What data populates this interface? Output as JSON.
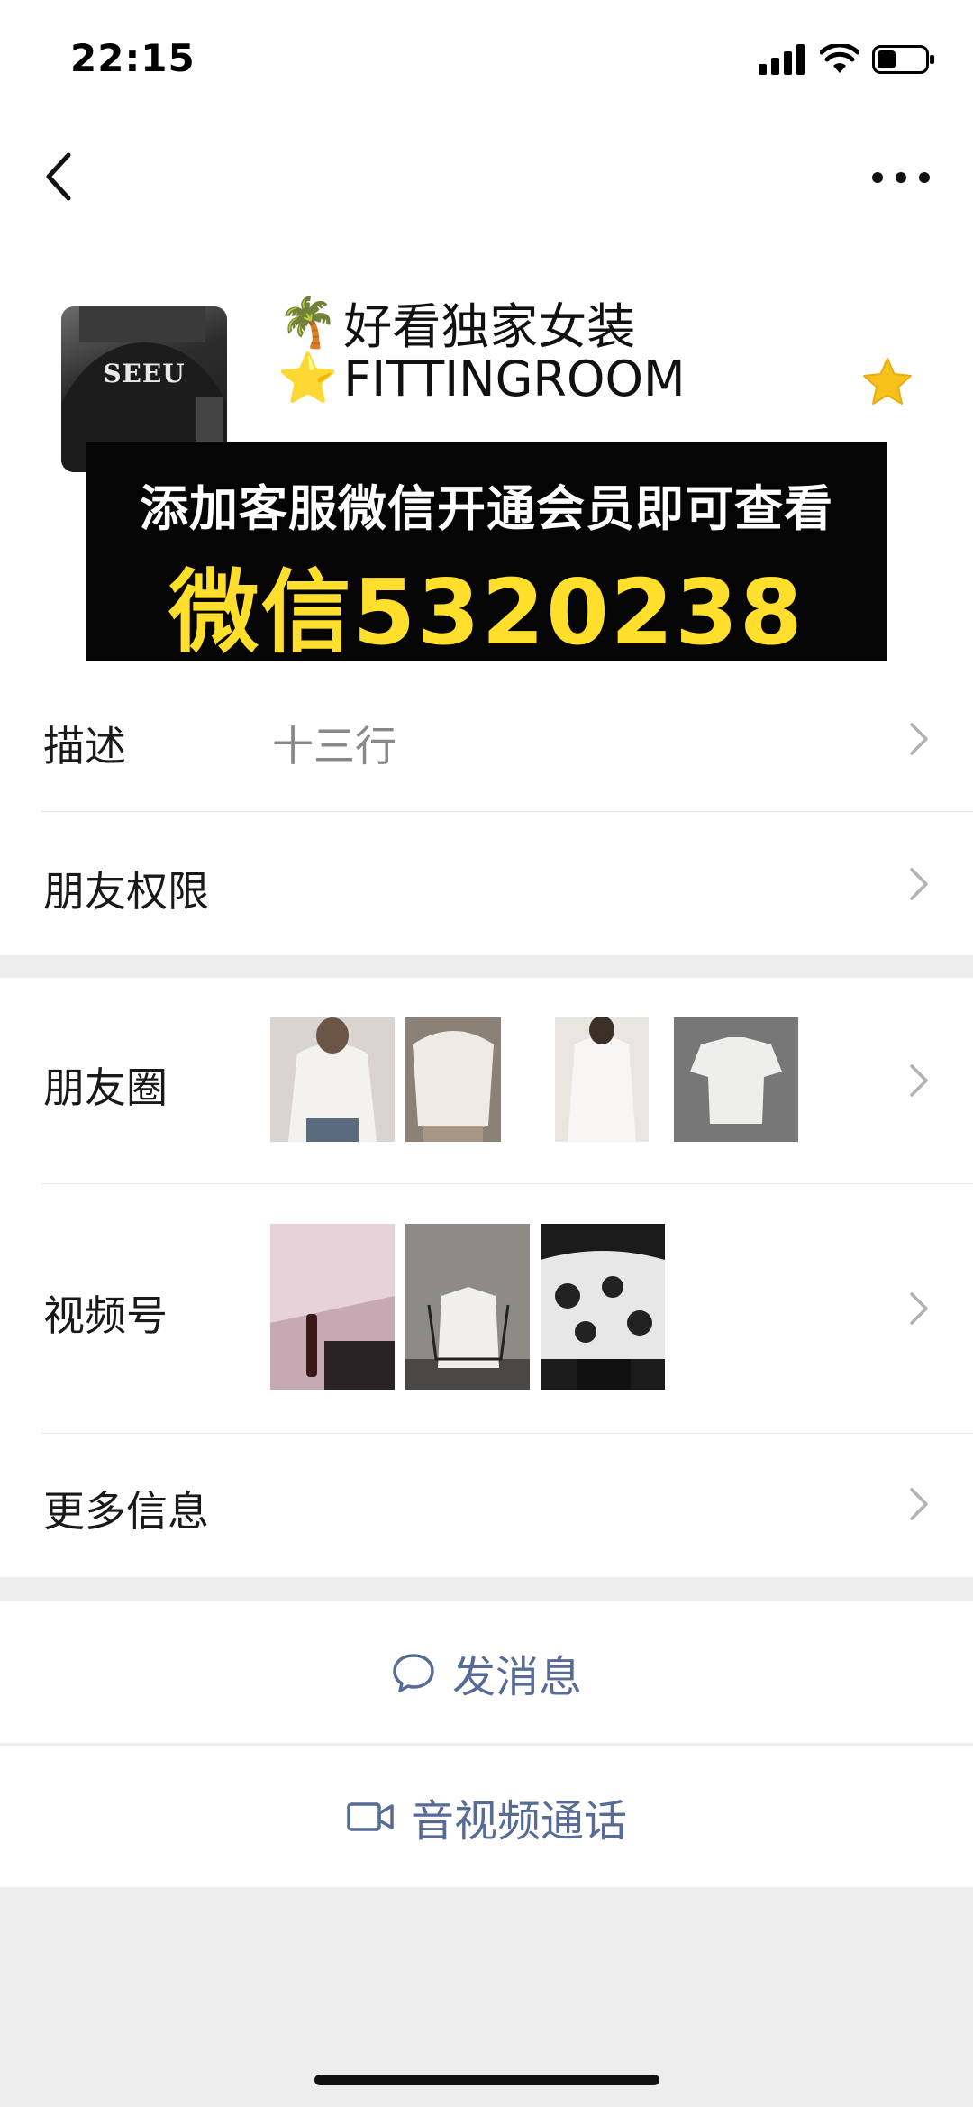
{
  "status": {
    "time": "22:15"
  },
  "profile": {
    "name_line_1": "好看独家女装",
    "name_line_2": "FITTINGROOM",
    "emoji_1": "🌴",
    "emoji_2": "⭐",
    "avatar_text": "SEEU",
    "star_color": "#f7c11b"
  },
  "overlay": {
    "line_1": "添加客服微信开通会员即可查看",
    "line_2": "微信5320238",
    "text_color": "#ffdf2c"
  },
  "rows": {
    "description": {
      "label": "描述",
      "value": "十三行"
    },
    "friend_permissions": {
      "label": "朋友权限"
    },
    "moments": {
      "label": "朋友圈"
    },
    "channels": {
      "label": "视频号"
    },
    "more_info": {
      "label": "更多信息"
    }
  },
  "actions": {
    "message": {
      "label": "发消息",
      "icon": "chat-bubble-icon"
    },
    "call": {
      "label": "音视频通话",
      "icon": "video-camera-icon"
    }
  },
  "colors": {
    "link": "#576b95",
    "background": "#ededed"
  }
}
